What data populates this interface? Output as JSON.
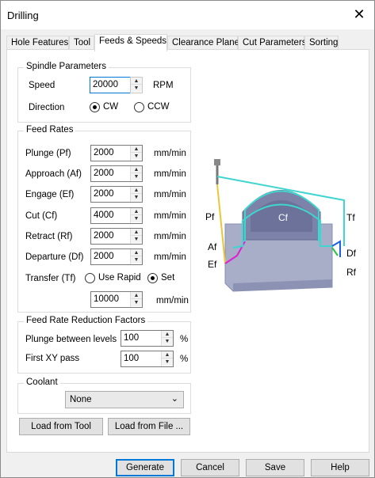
{
  "window": {
    "title": "Drilling",
    "close_glyph": "✕"
  },
  "tabs": [
    {
      "label": "Hole Features"
    },
    {
      "label": "Tool"
    },
    {
      "label": "Feeds & Speeds",
      "active": true
    },
    {
      "label": "Clearance Plane"
    },
    {
      "label": "Cut Parameters"
    },
    {
      "label": "Sorting"
    }
  ],
  "spindle": {
    "group_title": "Spindle Parameters",
    "speed_label": "Speed",
    "speed_value": "20000",
    "speed_unit": "RPM",
    "direction_label": "Direction",
    "cw_label": "CW",
    "ccw_label": "CCW",
    "selected": "CW"
  },
  "feed_rates": {
    "group_title": "Feed Rates",
    "rows": [
      {
        "label": "Plunge (Pf)",
        "value": "2000",
        "unit": "mm/min"
      },
      {
        "label": "Approach (Af)",
        "value": "2000",
        "unit": "mm/min"
      },
      {
        "label": "Engage (Ef)",
        "value": "2000",
        "unit": "mm/min"
      },
      {
        "label": "Cut (Cf)",
        "value": "4000",
        "unit": "mm/min"
      },
      {
        "label": "Retract (Rf)",
        "value": "2000",
        "unit": "mm/min"
      },
      {
        "label": "Departure  (Df)",
        "value": "2000",
        "unit": "mm/min"
      }
    ],
    "transfer_label": "Transfer (Tf)",
    "use_rapid_label": "Use Rapid",
    "set_label": "Set",
    "transfer_selected": "Set",
    "transfer_value": "10000",
    "transfer_unit": "mm/min"
  },
  "reduction": {
    "group_title": "Feed Rate Reduction Factors",
    "plunge_label": "Plunge between levels",
    "plunge_value": "100",
    "first_xy_label": "First XY pass",
    "first_xy_value": "100",
    "unit": "%"
  },
  "coolant": {
    "group_title": "Coolant",
    "selected": "None"
  },
  "load_buttons": {
    "from_tool": "Load from Tool",
    "from_file": "Load from File ..."
  },
  "diagram": {
    "labels": {
      "pf": "Pf",
      "af": "Af",
      "ef": "Ef",
      "cf": "Cf",
      "tf": "Tf",
      "df": "Df",
      "rf": "Rf"
    },
    "colors": {
      "plunge": "#e8c83a",
      "approach": "#e020d0",
      "cut": "#3fd6d0",
      "retract": "#2060e0",
      "depart": "#30c040",
      "block": "#a8adc8"
    }
  },
  "footer": {
    "generate": "Generate",
    "cancel": "Cancel",
    "save": "Save",
    "help": "Help"
  }
}
